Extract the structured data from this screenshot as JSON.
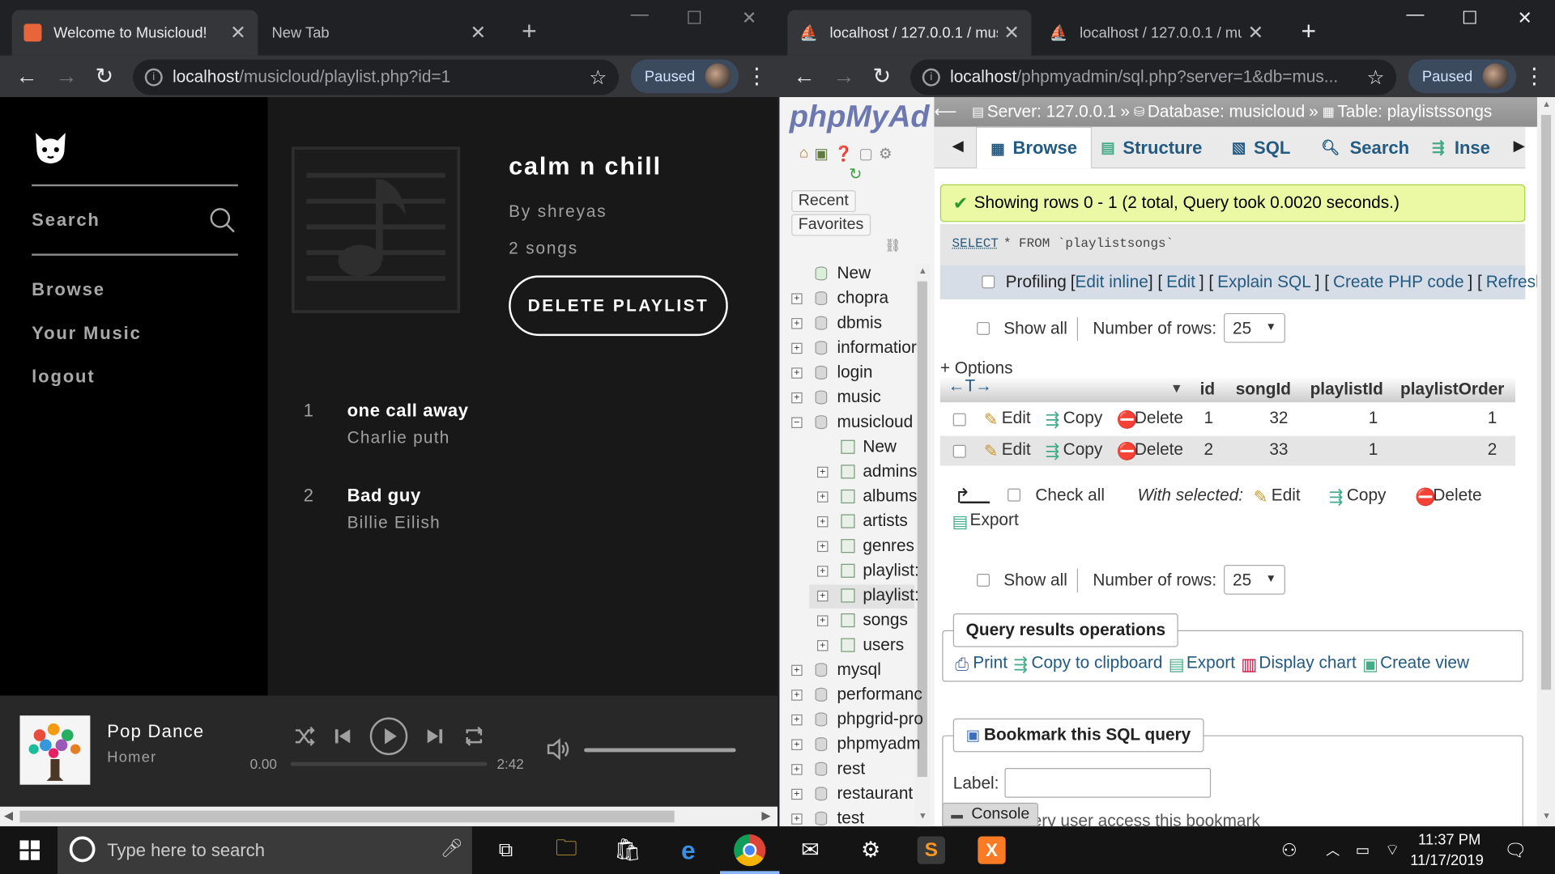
{
  "left_browser": {
    "tabs": [
      {
        "title": "Welcome to Musicloud!"
      },
      {
        "title": "New Tab"
      }
    ],
    "url_host": "localhost",
    "url_path": "/musicloud/playlist.php?id=1",
    "profile_label": "Paused"
  },
  "musicloud": {
    "sidebar": {
      "search_label": "Search",
      "nav": [
        "Browse",
        "Your Music",
        "logout"
      ]
    },
    "playlist": {
      "title": "calm n chill",
      "owner": "By shreyas",
      "count": "2 songs",
      "delete_label": "DELETE PLAYLIST"
    },
    "songs": [
      {
        "num": "1",
        "title": "one call away",
        "artist": "Charlie puth"
      },
      {
        "num": "2",
        "title": "Bad guy",
        "artist": "Billie Eilish"
      }
    ],
    "player": {
      "track": "Pop Dance",
      "artist": "Homer",
      "current": "0.00",
      "duration": "2:42",
      "progress": 0,
      "volume": 1
    }
  },
  "right_browser": {
    "tabs": [
      {
        "title": "localhost / 127.0.0.1 / mus"
      },
      {
        "title": "localhost / 127.0.0.1 / mu"
      }
    ],
    "url_host": "localhost",
    "url_path": "/phpmyadmin/sql.php?server=1&db=mus...",
    "profile_label": "Paused"
  },
  "phpmyadmin": {
    "logo": "phpMyAd",
    "recent": "Recent",
    "favorites": "Favorites",
    "breadcrumb": {
      "server": "Server: 127.0.0.1",
      "sep1": "»",
      "database": "Database: musicloud",
      "sep2": "»",
      "table": "Table: playlistssongs"
    },
    "tabs": [
      "Browse",
      "Structure",
      "SQL",
      "Search",
      "Inse"
    ],
    "tree": {
      "new": "New",
      "databases_top": [
        "chopra",
        "dbmis",
        "informatior",
        "login",
        "music",
        "musicloud"
      ],
      "musicloud_children": {
        "new": "New",
        "tables": [
          "admins",
          "albums",
          "artists",
          "genres",
          "playlist:",
          "playlist:",
          "songs",
          "users"
        ]
      },
      "databases_bottom": [
        "mysql",
        "performanc",
        "phpgrid-pro",
        "phpmyadm",
        "rest",
        "restaurant",
        "test"
      ]
    },
    "success": "Showing rows 0 - 1 (2 total, Query took 0.0020 seconds.)",
    "sql": {
      "keyword": "SELECT",
      "rest": " * FROM `playlistsongs`"
    },
    "profiling": {
      "label": "Profiling",
      "links": [
        "Edit inline",
        "Edit",
        "Explain SQL",
        "Create PHP code",
        "Refresh"
      ]
    },
    "show_all": "Show all",
    "rows_label": "Number of rows:",
    "rows_value": "25",
    "options": "+ Options",
    "columns": [
      "id",
      "songId",
      "playlistId",
      "playlistOrder"
    ],
    "actions": {
      "edit": "Edit",
      "copy": "Copy",
      "delete": "Delete"
    },
    "rows": [
      {
        "id": "1",
        "songId": "32",
        "playlistId": "1",
        "playlistOrder": "1"
      },
      {
        "id": "2",
        "songId": "33",
        "playlistId": "1",
        "playlistOrder": "2"
      }
    ],
    "check_all": "Check all",
    "with_selected": "With selected:",
    "export": "Export",
    "query_ops": {
      "title": "Query results operations",
      "items": [
        "Print",
        "Copy to clipboard",
        "Export",
        "Display chart",
        "Create view"
      ]
    },
    "bookmark": {
      "title": "Bookmark this SQL query",
      "label": "Label:",
      "note": "ery user access this bookmark"
    },
    "console": "Console"
  },
  "taskbar": {
    "search_placeholder": "Type here to search",
    "time": "11:37 PM",
    "date": "11/17/2019"
  }
}
